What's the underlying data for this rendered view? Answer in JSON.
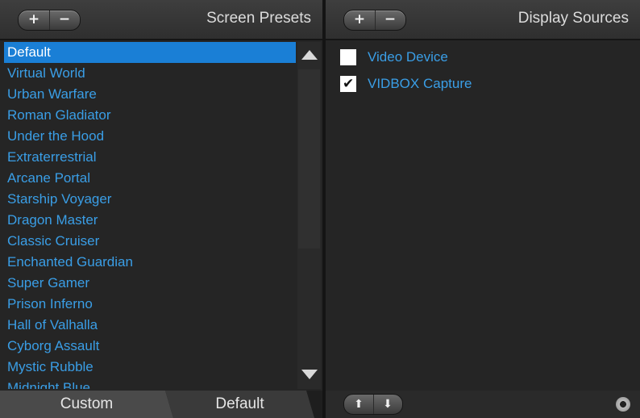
{
  "left_panel": {
    "title": "Screen Presets",
    "add_icon": "plus-icon",
    "remove_icon": "minus-icon",
    "presets": [
      {
        "label": "Default",
        "selected": true
      },
      {
        "label": "Virtual World",
        "selected": false
      },
      {
        "label": "Urban Warfare",
        "selected": false
      },
      {
        "label": "Roman Gladiator",
        "selected": false
      },
      {
        "label": "Under the Hood",
        "selected": false
      },
      {
        "label": "Extraterrestrial",
        "selected": false
      },
      {
        "label": "Arcane Portal",
        "selected": false
      },
      {
        "label": "Starship Voyager",
        "selected": false
      },
      {
        "label": "Dragon Master",
        "selected": false
      },
      {
        "label": "Classic Cruiser",
        "selected": false
      },
      {
        "label": "Enchanted Guardian",
        "selected": false
      },
      {
        "label": "Super Gamer",
        "selected": false
      },
      {
        "label": "Prison Inferno",
        "selected": false
      },
      {
        "label": "Hall of Valhalla",
        "selected": false
      },
      {
        "label": "Cyborg Assault",
        "selected": false
      },
      {
        "label": "Mystic Rubble",
        "selected": false
      },
      {
        "label": "Midnight Blue",
        "selected": false
      }
    ],
    "tabs": {
      "custom": "Custom",
      "default": "Default"
    }
  },
  "right_panel": {
    "title": "Display Sources",
    "sources": [
      {
        "label": "Video Device",
        "checked": false
      },
      {
        "label": "VIDBOX Capture",
        "checked": true
      }
    ],
    "move_up_icon": "arrow-up-icon",
    "move_down_icon": "arrow-down-icon",
    "settings_icon": "gear-icon"
  },
  "colors": {
    "accent": "#1a7fd6",
    "link_text": "#3a9ee6",
    "background": "#252525"
  }
}
